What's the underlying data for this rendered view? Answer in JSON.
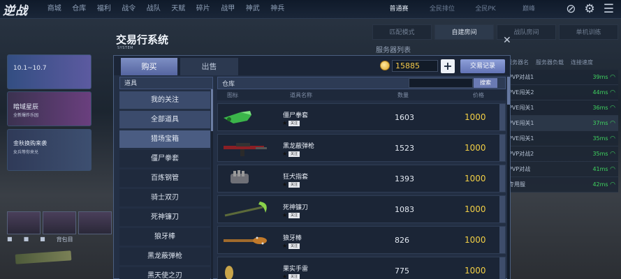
{
  "topbar": {
    "logo": "逆战",
    "nav": [
      "商城",
      "仓库",
      "福利",
      "战令",
      "战队",
      "天赋",
      "碎片",
      "战甲",
      "神武",
      "神兵"
    ],
    "modes": [
      "普通赛",
      "全民排位",
      "全民PK",
      "巅峰"
    ]
  },
  "side": {
    "card_a_title": "10.1~10.7",
    "card_b_title": "暗域星辰",
    "card_b_sub": "全新爆炸乐园",
    "card_c_title": "金秋换购来袭",
    "card_c_sub": "女兵等你来兑",
    "promo": "免费领",
    "pager_label": "背包目"
  },
  "right_panel": {
    "tabs": [
      "匹配模式",
      "自建房间",
      "战队房间",
      "单机训练"
    ],
    "active_tab": 1,
    "server_title": "服务器列表",
    "server_cols": [
      "服务器名",
      "服务器负载",
      "连接速度"
    ],
    "servers": [
      {
        "name": "PVP对战1",
        "ms": "39ms",
        "hot": false
      },
      {
        "name": "PVE闯关2",
        "ms": "44ms",
        "hot": false
      },
      {
        "name": "PVE闯关1",
        "ms": "36ms",
        "hot": false
      },
      {
        "name": "PVE闯关1",
        "ms": "37ms",
        "hot": true
      },
      {
        "name": "PVE闯关1",
        "ms": "35ms",
        "hot": false
      },
      {
        "name": "PVP对战2",
        "ms": "35ms",
        "hot": false
      },
      {
        "name": "PVP对战",
        "ms": "41ms",
        "hot": false
      },
      {
        "name": "专用服",
        "ms": "42ms",
        "hot": false
      }
    ]
  },
  "modal": {
    "title": "交易行系统",
    "subtitle": "SYSTEM",
    "tab_buy": "购买",
    "tab_sell": "出售",
    "coins": "15885",
    "plus": "+",
    "record_button": "交易记录",
    "category_header": "道具",
    "categories": [
      {
        "label": "我的关注",
        "type": "grp"
      },
      {
        "label": "全部道具",
        "type": "grp"
      },
      {
        "label": "猎场宝箱",
        "type": "sel"
      },
      {
        "label": "僵尸拳套",
        "type": "sub"
      },
      {
        "label": "百炼钢管",
        "type": "sub"
      },
      {
        "label": "骑士双刃",
        "type": "sub"
      },
      {
        "label": "死神镰刀",
        "type": "sub"
      },
      {
        "label": "狼牙棒",
        "type": "sub"
      },
      {
        "label": "黑龙蔽弹枪",
        "type": "sub"
      },
      {
        "label": "黑天使之刃",
        "type": "sub"
      }
    ],
    "list_header": "仓库",
    "search_placeholder": "",
    "search_button": "搜索",
    "columns": [
      "图标",
      "道具名称",
      "数量",
      "价格"
    ],
    "items": [
      {
        "name": "僵尸拳套",
        "tag": "关注",
        "qty": "1603",
        "price": "1000"
      },
      {
        "name": "黑龙蔽弹枪",
        "tag": "关注",
        "qty": "1523",
        "price": "1000"
      },
      {
        "name": "狂犬指套",
        "tag": "关注",
        "qty": "1393",
        "price": "1000"
      },
      {
        "name": "死神镰刀",
        "tag": "关注",
        "qty": "1083",
        "price": "1000"
      },
      {
        "name": "狼牙棒",
        "tag": "关注",
        "qty": "826",
        "price": "1000"
      },
      {
        "name": "果实手雷",
        "tag": "关注",
        "qty": "775",
        "price": "1000"
      }
    ]
  }
}
